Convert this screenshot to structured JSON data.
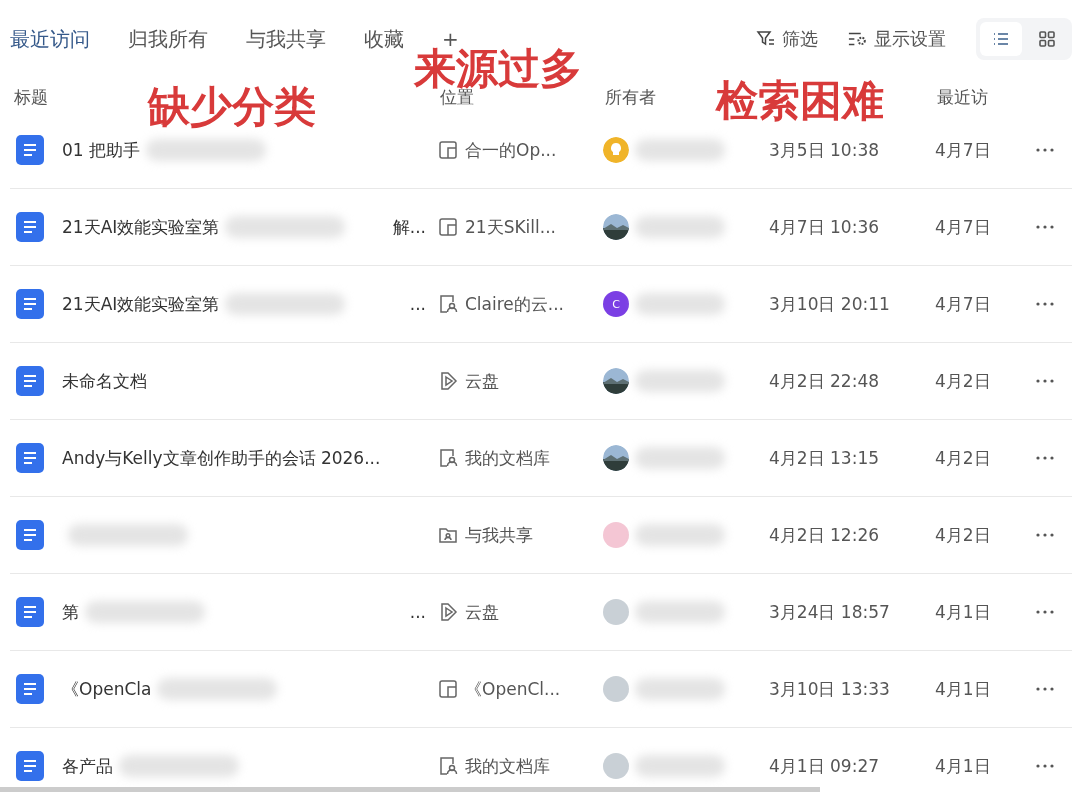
{
  "tabs": [
    {
      "label": "最近访问",
      "selected": true
    },
    {
      "label": "归我所有",
      "selected": false
    },
    {
      "label": "与我共享",
      "selected": false
    },
    {
      "label": "收藏",
      "selected": false
    },
    {
      "label": "+",
      "selected": false
    }
  ],
  "toolbar": {
    "filter": "筛选",
    "display_settings": "显示设置",
    "views": [
      {
        "kind": "list",
        "selected": true
      },
      {
        "kind": "grid",
        "selected": false
      }
    ]
  },
  "columns": [
    "标题",
    "位置",
    "所有者",
    "最近访"
  ],
  "annotations": [
    "缺少分类",
    "来源过多",
    "检索困难"
  ],
  "rows": [
    {
      "title": "01 把助手",
      "title_blurred": true,
      "location": {
        "kind": "space",
        "text": "合一的Op..."
      },
      "owner": {
        "kind": "bulb",
        "color": "#f0b429"
      },
      "created": "3月5日 10:38",
      "visited": "4月7日"
    },
    {
      "title": "21天AI效能实验室第",
      "title_blurred": true,
      "title_end": "解...",
      "location": {
        "kind": "space",
        "text": "21天SKill..."
      },
      "owner": {
        "kind": "photo"
      },
      "created": "4月7日 10:36",
      "visited": "4月7日"
    },
    {
      "title": "21天AI效能实验室第",
      "title_blurred": true,
      "title_end": "...",
      "location": {
        "kind": "library",
        "text": "Claire的云..."
      },
      "owner": {
        "kind": "letter",
        "color": "#7b3fe4",
        "letter": "C"
      },
      "created": "3月10日 20:11",
      "visited": "4月7日"
    },
    {
      "title": "未命名文档",
      "title_blurred": false,
      "location": {
        "kind": "cloud",
        "text": "云盘"
      },
      "owner": {
        "kind": "photo"
      },
      "created": "4月2日 22:48",
      "visited": "4月2日"
    },
    {
      "title": "Andy与Kelly文章创作助手的会话 2026...",
      "title_blurred": false,
      "location": {
        "kind": "library",
        "text": "我的文档库"
      },
      "owner": {
        "kind": "photo"
      },
      "created": "4月2日 13:15",
      "visited": "4月2日"
    },
    {
      "title": "",
      "title_blurred": true,
      "location": {
        "kind": "shared",
        "text": "与我共享"
      },
      "owner": {
        "kind": "blank",
        "color": "#f4c6d4"
      },
      "created": "4月2日 12:26",
      "visited": "4月2日"
    },
    {
      "title": "第",
      "title_blurred": true,
      "title_end": "...",
      "location": {
        "kind": "cloud",
        "text": "云盘"
      },
      "owner": {
        "kind": "blank",
        "color": "#c9d0d6"
      },
      "created": "3月24日 18:57",
      "visited": "4月1日"
    },
    {
      "title": "《OpenCla",
      "title_blurred": true,
      "location": {
        "kind": "space",
        "text": "《OpenCl..."
      },
      "owner": {
        "kind": "blank",
        "color": "#c9d0d6"
      },
      "created": "3月10日 13:33",
      "visited": "4月1日"
    },
    {
      "title": "各产品",
      "title_blurred": true,
      "location": {
        "kind": "library",
        "text": "我的文档库"
      },
      "owner": {
        "kind": "blank",
        "color": "#c9d0d6"
      },
      "created": "4月1日 09:27",
      "visited": "4月1日"
    }
  ]
}
